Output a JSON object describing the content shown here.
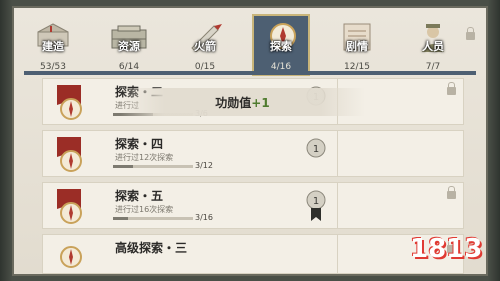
{
  "tabs": [
    {
      "name": "建造",
      "count": "53/53",
      "icon": "building-model-icon",
      "active": false
    },
    {
      "name": "资源",
      "count": "6/14",
      "icon": "crate-icon",
      "active": false
    },
    {
      "name": "火箭",
      "count": "0/15",
      "icon": "rocket-icon",
      "active": false
    },
    {
      "name": "探索",
      "count": "4/16",
      "icon": "compass-icon",
      "active": true
    },
    {
      "name": "剧情",
      "count": "12/15",
      "icon": "book-icon",
      "active": false
    },
    {
      "name": "人员",
      "count": "7/7",
      "icon": "soldier-icon",
      "active": false
    }
  ],
  "rows": [
    {
      "title": "探索・二",
      "desc": "进行过",
      "progress": "3/6",
      "fraction": 0.5,
      "locked": true,
      "medal": "1"
    },
    {
      "title": "探索・四",
      "desc": "进行过12次探索",
      "progress": "3/12",
      "fraction": 0.25,
      "locked": false,
      "medal": "1"
    },
    {
      "title": "探索・五",
      "desc": "进行过16次探索",
      "progress": "3/16",
      "fraction": 0.19,
      "locked": true,
      "medal": "1"
    },
    {
      "title": "高级探索・三",
      "desc": "",
      "progress": "",
      "fraction": 0,
      "locked": true,
      "medal": ""
    }
  ],
  "toast": {
    "label": "功勋值",
    "value": "+1"
  },
  "watermark": {
    "text": "1813"
  },
  "colors": {
    "active_tab": "#4d5f72",
    "flag_red": "#9b2d26",
    "plus_green": "#4f7b2e"
  }
}
